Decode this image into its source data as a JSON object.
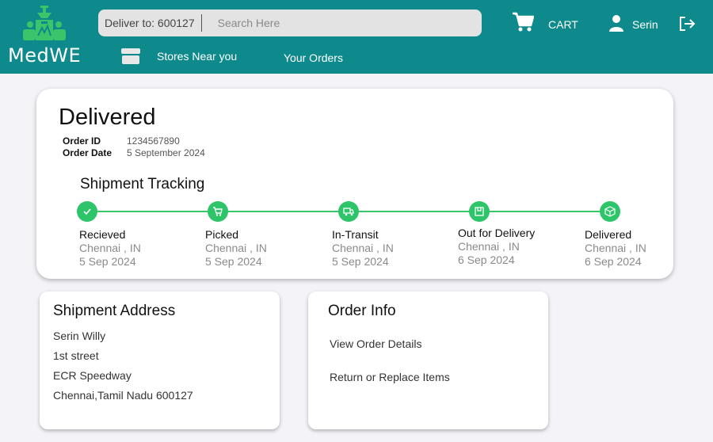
{
  "header": {
    "logo_text": "MedWE",
    "deliver_to": "Deliver to: 600127",
    "search_placeholder": "Search Here",
    "cart_label": "CART",
    "user_name": "Serin",
    "stores_label": "Stores Near you",
    "orders_label": "Your Orders",
    "brand_color": "#0f8a8c"
  },
  "order": {
    "status": "Delivered",
    "id_label": "Order ID",
    "id_value": "1234567890",
    "date_label": "Order Date",
    "date_value": "5 September 2024"
  },
  "tracking": {
    "title": "Shipment Tracking",
    "accent_color": "#2ec46a",
    "steps": [
      {
        "label": "Recieved",
        "location": "Chennai , IN",
        "date": "5 Sep 2024",
        "icon": "check-icon"
      },
      {
        "label": "Picked",
        "location": "Chennai , IN",
        "date": "5 Sep 2024",
        "icon": "cart-icon"
      },
      {
        "label": "In-Transit",
        "location": "Chennai , IN",
        "date": "5 Sep 2024",
        "icon": "truck-icon"
      },
      {
        "label": "Out for Delivery",
        "location": "Chennai , IN",
        "date": "6 Sep 2024",
        "icon": "delivery-box-icon"
      },
      {
        "label": "Delivered",
        "location": "Chennai , IN",
        "date": "6 Sep 2024",
        "icon": "package-icon"
      }
    ]
  },
  "address": {
    "title": "Shipment Address",
    "lines": [
      "Serin Willy",
      "1st street",
      "ECR Speedway",
      "Chennai,Tamil Nadu 600127"
    ]
  },
  "order_info": {
    "title": "Order Info",
    "links": [
      "View Order Details",
      "Return or Replace Items"
    ]
  }
}
